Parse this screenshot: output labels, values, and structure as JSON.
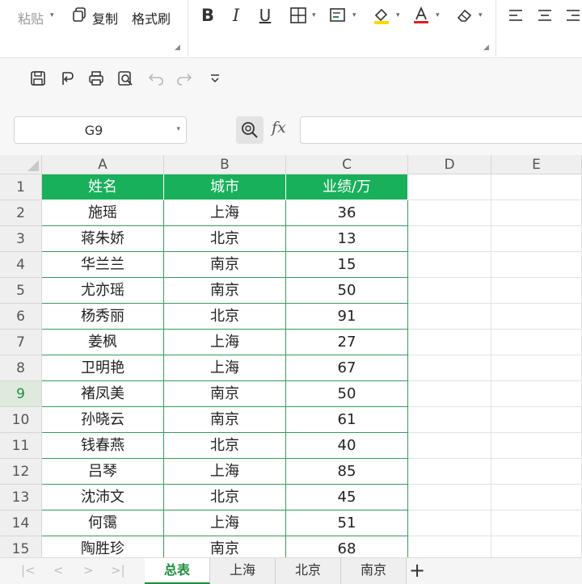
{
  "ribbon": {
    "paste_label": "粘贴",
    "copy_label": "复制",
    "format_painter_label": "格式刷"
  },
  "formula_bar": {
    "name_box": "G9",
    "fx_label": "fx",
    "formula": ""
  },
  "grid": {
    "columns": [
      "A",
      "B",
      "C",
      "D",
      "E"
    ],
    "row_numbers": [
      "1",
      "2",
      "3",
      "4",
      "5",
      "6",
      "7",
      "8",
      "9",
      "10",
      "11",
      "12",
      "13",
      "14",
      "15"
    ],
    "selected_cell": "G9",
    "header": [
      "姓名",
      "城市",
      "业绩/万"
    ],
    "rows": [
      [
        "施瑶",
        "上海",
        "36"
      ],
      [
        "蒋朱娇",
        "北京",
        "13"
      ],
      [
        "华兰兰",
        "南京",
        "15"
      ],
      [
        "尤亦瑶",
        "南京",
        "50"
      ],
      [
        "杨秀丽",
        "北京",
        "91"
      ],
      [
        "姜枫",
        "上海",
        "27"
      ],
      [
        "卫明艳",
        "上海",
        "67"
      ],
      [
        "褚凤美",
        "南京",
        "50"
      ],
      [
        "孙晓云",
        "南京",
        "61"
      ],
      [
        "钱春燕",
        "北京",
        "40"
      ],
      [
        "吕琴",
        "上海",
        "85"
      ],
      [
        "沈沛文",
        "北京",
        "45"
      ],
      [
        "何霭",
        "上海",
        "51"
      ],
      [
        "陶胜珍",
        "南京",
        "68"
      ]
    ]
  },
  "sheets": {
    "tabs": [
      "总表",
      "上海",
      "北京",
      "南京"
    ],
    "active": "总表",
    "add_label": "+"
  },
  "colors": {
    "header_fill": "#18b05a",
    "table_border": "#2e9f5b",
    "accent": "#1e8e3e"
  }
}
